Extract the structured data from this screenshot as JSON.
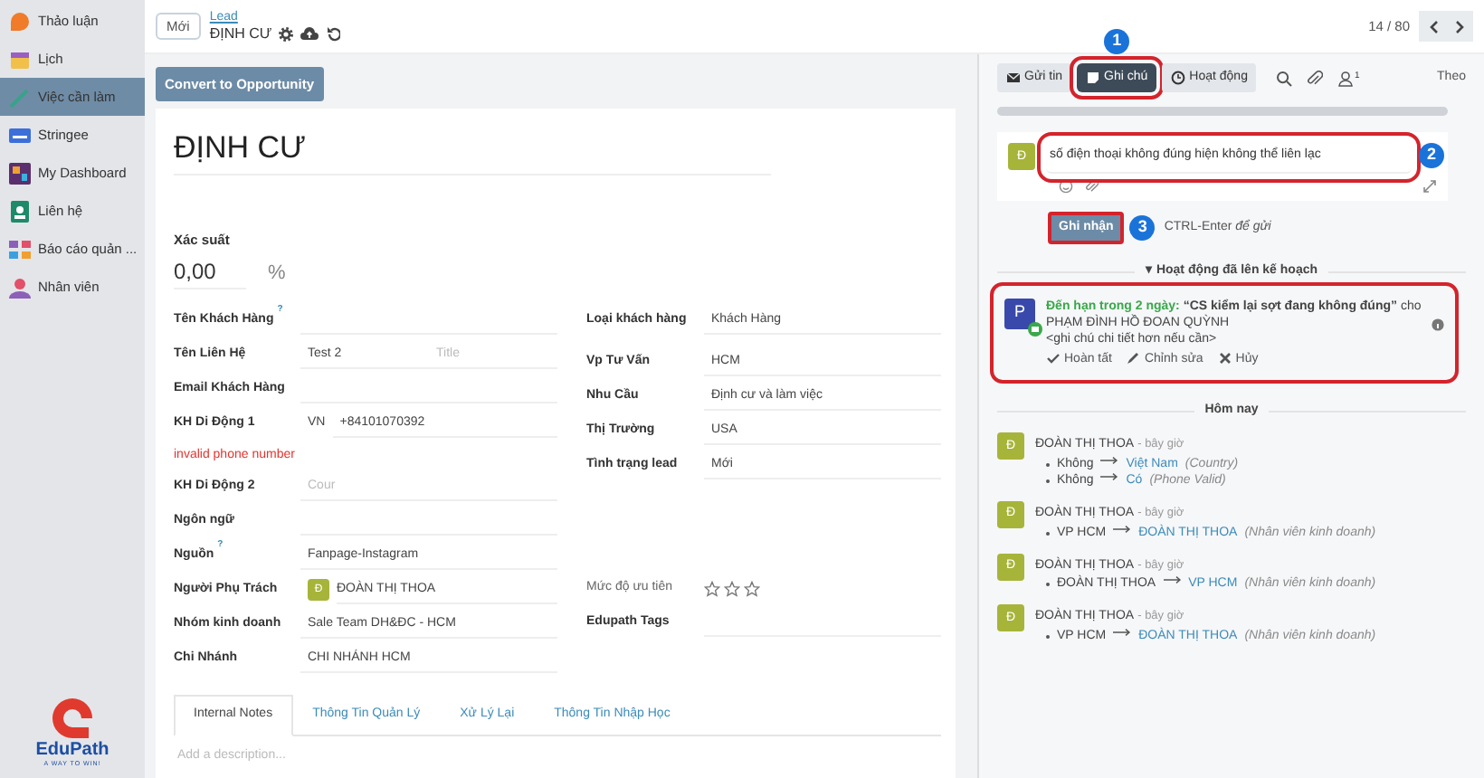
{
  "sidebar": {
    "items": [
      {
        "label": "Thảo luận",
        "kind": "discuss",
        "selected": false
      },
      {
        "label": "Lịch",
        "kind": "calendar",
        "selected": false
      },
      {
        "label": "Việc cần làm",
        "kind": "todo",
        "selected": true
      },
      {
        "label": "Stringee",
        "kind": "phone",
        "selected": false
      },
      {
        "label": "My Dashboard",
        "kind": "dashboard",
        "selected": false
      },
      {
        "label": "Liên hệ",
        "kind": "contacts",
        "selected": false
      },
      {
        "label": "Báo cáo quản ...",
        "kind": "reports",
        "selected": false
      },
      {
        "label": "Nhân viên",
        "kind": "employees",
        "selected": false
      }
    ],
    "logo": {
      "name": "EduPath",
      "tagline": "A WAY TO WIN!"
    }
  },
  "topbar": {
    "new_button": "Mới",
    "breadcrumb": "Lead",
    "record": "ĐỊNH CƯ",
    "pager": "14 / 80"
  },
  "form": {
    "convert_button": "Convert to Opportunity",
    "title": "ĐỊNH CƯ",
    "probability": {
      "label": "Xác suất",
      "value": "0,00",
      "unit": "%"
    },
    "left_fields": [
      {
        "label": "Tên Khách Hàng",
        "help": "?",
        "kind": "text"
      },
      {
        "label": "Tên Liên Hệ",
        "kind": "pair",
        "value": "Test 2",
        "placeholder": "Title"
      },
      {
        "label": "Email Khách Hàng",
        "kind": "text"
      },
      {
        "label": "KH Di Động 1",
        "kind": "phone",
        "country": "VN",
        "value": "+84101070392",
        "error": "invalid phone number"
      },
      {
        "label": "KH Di Động 2",
        "kind": "text",
        "placeholder": "Cour"
      },
      {
        "label": "Ngôn ngữ",
        "kind": "text"
      },
      {
        "label": "Nguồn",
        "help": "?",
        "kind": "text",
        "value": "Fanpage-Instagram"
      },
      {
        "label": "Người Phụ Trách",
        "kind": "user",
        "avatar": "Đ",
        "value": "ĐOÀN THỊ THOA"
      },
      {
        "label": "Nhóm kinh doanh",
        "kind": "text",
        "value": "Sale Team DH&ĐC - HCM"
      },
      {
        "label": "Chi Nhánh",
        "kind": "text",
        "value": "CHI NHÁNH HCM"
      }
    ],
    "right_fields": [
      {
        "label": "Loại khách hàng",
        "kind": "text",
        "value": "Khách Hàng"
      },
      {
        "label": "Vp Tư Vấn",
        "kind": "text",
        "value": "HCM"
      },
      {
        "label": "Nhu Cầu",
        "kind": "text",
        "value": "Định cư và làm việc"
      },
      {
        "label": "Thị Trường",
        "kind": "text",
        "value": "USA"
      },
      {
        "label": "Tình trạng lead",
        "kind": "text",
        "value": "Mới"
      },
      {
        "label": "Mức độ ưu tiên",
        "kind": "stars",
        "stars": 0
      },
      {
        "label": "Edupath Tags",
        "kind": "text"
      }
    ],
    "tabs": [
      {
        "label": "Internal Notes",
        "selected": true
      },
      {
        "label": "Thông Tin Quản Lý",
        "selected": false
      },
      {
        "label": "Xử Lý Lại",
        "selected": false
      },
      {
        "label": "Thông Tin Nhập Học",
        "selected": false
      }
    ],
    "description_placeholder": "Add a description..."
  },
  "chatter": {
    "tabs": [
      {
        "label": "Gửi tin",
        "kind": "message",
        "selected": false,
        "highlighted": false
      },
      {
        "label": "Ghi chú",
        "kind": "note",
        "selected": true,
        "highlighted": true,
        "callout": "1"
      },
      {
        "label": "Hoạt động",
        "kind": "activity",
        "selected": false,
        "highlighted": false
      }
    ],
    "followers": "1",
    "follow_label": "Theo",
    "composer": {
      "avatar": "Đ",
      "value": "số điện thoại không đúng hiện không thể liên lạc",
      "highlighted": true,
      "callout": "2"
    },
    "submit": {
      "label": "Ghi nhận",
      "highlighted": true,
      "callout": "3"
    },
    "hint": "CTRL-Enter *để gửi*",
    "planned_header": "▾ Hoạt động đã lên kế hoạch",
    "activity": {
      "avatar": "P",
      "due": "Đến hạn trong 2 ngày:",
      "summary": "**“CS kiểm lại sợt đang không đúng”** cho PHẠM ĐÌNH HỒ ĐOAN QUỲNH",
      "note": "<ghi chú chi tiết hơn nếu cần>",
      "actions": [
        "Hoàn tất",
        "Chỉnh sửa",
        "Hủy"
      ],
      "highlighted": true
    },
    "today": "Hôm nay",
    "messages": [
      {
        "avatar": "Đ",
        "author": "ĐOÀN THỊ THOA",
        "time": "- bây giờ",
        "changes": [
          {
            "old": "Không",
            "new": "Việt Nam",
            "field": "(Country)"
          },
          {
            "old": "Không",
            "new": "Có",
            "field": "(Phone Valid)"
          }
        ]
      },
      {
        "avatar": "Đ",
        "author": "ĐOÀN THỊ THOA",
        "time": "- bây giờ",
        "changes": [
          {
            "old": "VP HCM",
            "new": "ĐOÀN THỊ THOA",
            "field": "(Nhân viên kinh doanh)"
          }
        ]
      },
      {
        "avatar": "Đ",
        "author": "ĐOÀN THỊ THOA",
        "time": "- bây giờ",
        "changes": [
          {
            "old": "ĐOÀN THỊ THOA",
            "new": "VP HCM",
            "field": "(Nhân viên kinh doanh)"
          }
        ]
      },
      {
        "avatar": "Đ",
        "author": "ĐOÀN THỊ THOA",
        "time": "- bây giờ",
        "changes": [
          {
            "old": "VP HCM",
            "new": "ĐOÀN THỊ THOA",
            "field": "(Nhân viên kinh doanh)"
          }
        ]
      }
    ]
  }
}
